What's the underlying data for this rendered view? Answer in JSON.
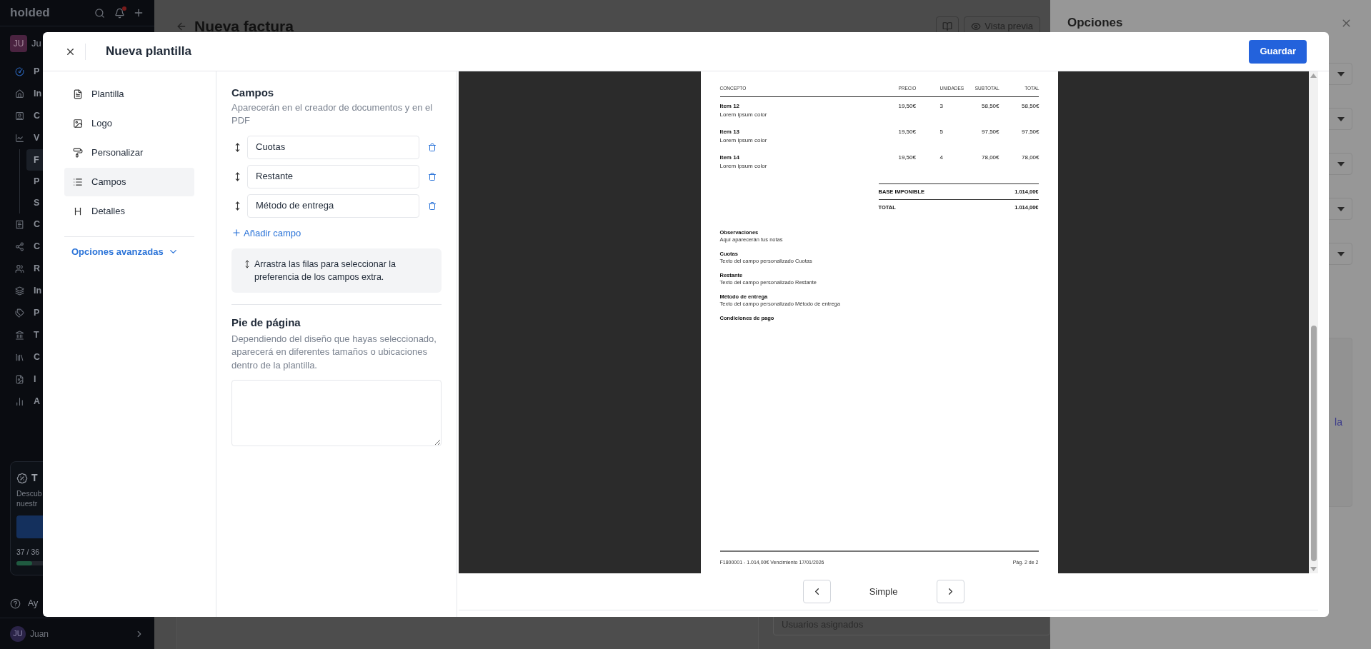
{
  "app_sidebar": {
    "logo": "holded",
    "user": {
      "initials": "JU",
      "name": "Ju"
    },
    "items": [
      {
        "label": "P",
        "accent": true
      },
      {
        "label": "In",
        "accent": false
      },
      {
        "label": "C",
        "accent": false
      },
      {
        "label": "V",
        "accent": false,
        "children": [
          {
            "label": "F",
            "selected": true
          },
          {
            "label": "P",
            "selected": false
          },
          {
            "label": "S",
            "selected": false
          }
        ]
      },
      {
        "label": "C",
        "accent": false
      },
      {
        "label": "C",
        "accent": false
      },
      {
        "label": "R",
        "accent": false
      },
      {
        "label": "In",
        "accent": false
      },
      {
        "label": "P",
        "accent": false
      },
      {
        "label": "T",
        "accent": false
      },
      {
        "label": "C",
        "accent": false
      },
      {
        "label": "I",
        "accent": false
      },
      {
        "label": "A",
        "accent": false
      }
    ],
    "promo": {
      "title": "T",
      "text_lines": [
        "Descub",
        "nuestr"
      ],
      "progress_label": "37 / 36",
      "level": 0.13
    },
    "help": "Ay",
    "footer_user": {
      "initials": "JU",
      "name": "Juan"
    }
  },
  "main": {
    "title": "Nueva factura",
    "buttons": [
      {
        "kind": "icon"
      },
      {
        "kind": "text",
        "label": "Vista previa"
      }
    ],
    "assigned_users_field": {
      "placeholder": "Usuarios asignados"
    }
  },
  "options_panel": {
    "title": "Opciones",
    "selects": [
      {
        "kind": "dropdown"
      },
      {
        "kind": "dropdown"
      },
      {
        "kind": "dropdown"
      },
      {
        "kind": "dropdown"
      },
      {
        "kind": "dropdown"
      }
    ],
    "note_fragment": "la"
  },
  "modal": {
    "title": "Nueva plantilla",
    "save_button": "Guardar",
    "nav": [
      {
        "label": "Plantilla",
        "selected": false
      },
      {
        "label": "Logo",
        "selected": false
      },
      {
        "label": "Personalizar",
        "selected": false
      },
      {
        "label": "Campos",
        "selected": true
      },
      {
        "label": "Detalles",
        "selected": false
      }
    ],
    "advanced_options": "Opciones avanzadas",
    "fields_section": {
      "title": "Campos",
      "description": "Aparecerán en el creador de documentos y en el PDF",
      "custom_fields": [
        {
          "value": "Cuotas"
        },
        {
          "value": "Restante"
        },
        {
          "value": "Método de entrega"
        }
      ],
      "add_button": "Añadir campo",
      "hint": "Arrastra las filas para seleccionar la preferencia de los campos extra."
    },
    "footer_section": {
      "title": "Pie de página",
      "description": "Dependiendo del diseño que hayas seleccionado, aparecerá en diferentes tamaños o ubicaciones dentro de la plantilla."
    },
    "preview": {
      "document": {
        "columns": [
          "CONCEPTO",
          "PRECIO",
          "UNIDADES",
          "SUBTOTAL",
          "TOTAL"
        ],
        "rows": [
          {
            "concept": "Item 12",
            "description": "Lorem ipsum color",
            "price": "19,50€",
            "units": "3",
            "subtotal": "58,50€",
            "total": "58,50€"
          },
          {
            "concept": "Item 13",
            "description": "Lorem ipsum color",
            "price": "19,50€",
            "units": "5",
            "subtotal": "97,50€",
            "total": "97,50€"
          },
          {
            "concept": "Item 14",
            "description": "Lorem ipsum color",
            "price": "19,50€",
            "units": "4",
            "subtotal": "78,00€",
            "total": "78,00€"
          }
        ],
        "totals": [
          {
            "label": "BASE IMPONIBLE",
            "value": "1.014,00€"
          },
          {
            "label": "TOTAL",
            "value": "1.014,00€"
          }
        ],
        "notes": [
          {
            "title": "Observaciones",
            "text": "Aquí aparecerán tus notas"
          },
          {
            "title": "Cuotas",
            "text": "Texto del campo personalizado Cuotas"
          },
          {
            "title": "Restante",
            "text": "Texto del campo personalizado Restante"
          },
          {
            "title": "Método de entrega",
            "text": "Texto del campo personalizado Método de entrega"
          },
          {
            "title": "Condiciones de pago"
          }
        ],
        "footer_left": "F1800001 - 1.014,00€ Vencimiento 17/01/2026",
        "footer_right": "Pág. 2 de 2"
      },
      "template_label": "Simple"
    }
  }
}
